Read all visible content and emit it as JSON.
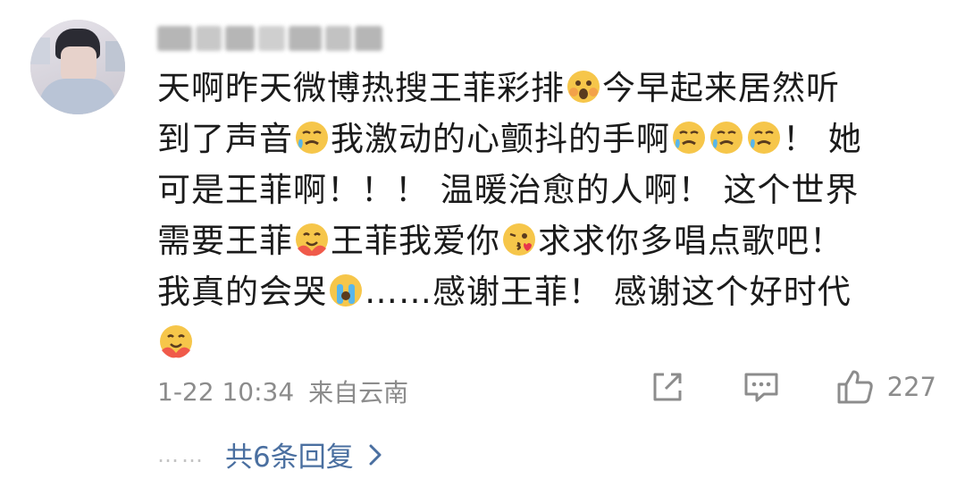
{
  "comment": {
    "username": "",
    "line1_a": "天啊昨天微博热搜王菲彩排",
    "line1_b": "今早起来居然听",
    "line2_a": "到了声音",
    "line2_b": "我激动的心颤抖的手啊",
    "line2_c": "！ 她",
    "line3": "可是王菲啊！！！ 温暖治愈的人啊！ 这个世界",
    "line4_a": "需要王菲",
    "line4_b": "王菲我爱你",
    "line4_c": "求求你多唱点歌吧！",
    "line5_a": "我真的会哭",
    "line5_b": "……感谢王菲！ 感谢这个好时代",
    "time": "1-22 10:34",
    "location": "来自云南",
    "like_count": "227",
    "replies_label": "共6条回复",
    "dots": "……"
  },
  "colors": {
    "text": "#1b1b1b",
    "meta": "#8c8c8c",
    "link": "#4a6fa0"
  },
  "icons": [
    "share-icon",
    "comment-icon",
    "like-icon",
    "chevron-right-icon"
  ]
}
